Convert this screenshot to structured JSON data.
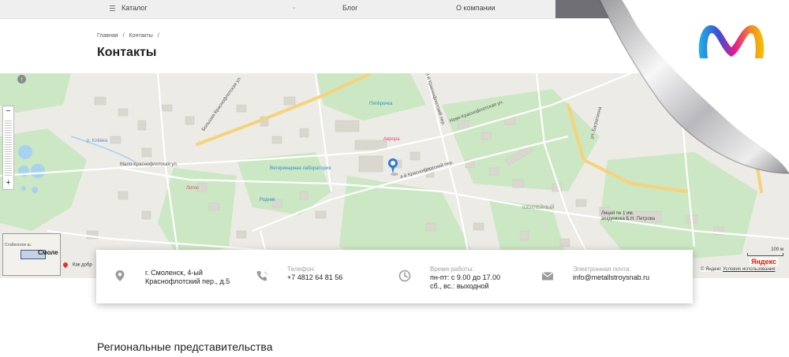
{
  "topnav": {
    "items": [
      {
        "label": "Каталог"
      },
      {
        "label": "Блог"
      },
      {
        "label": "О компании"
      }
    ]
  },
  "breadcrumb": {
    "items": [
      "Главная",
      "/",
      "Контакты",
      "/"
    ]
  },
  "page": {
    "title": "Контакты",
    "section_title": "Региональные представительства"
  },
  "map": {
    "streets": [
      "Ново-Краснофлотская ул.",
      "Мало-Краснофлотская ул.",
      "4-й Краснофлотский пер.",
      "3-й Краснофлотский пер.",
      "Большая Краснофлотская ул.",
      "р. Клёвка",
      "ул. Багратиона"
    ],
    "pois": [
      "Пятёрочка",
      "Аврора",
      "Ветеринарная лаборатория",
      "Лотос",
      "Родник",
      "ЮБИЛЕЙНЫЙ",
      "Лицей № 1 им. академика Б.Н. Петрова"
    ],
    "minimap_city": "Смоле",
    "minimap_tiny": "Стабенское ш.",
    "route_hint": "Как добр",
    "scale_label": "100 м",
    "yandex_logo": "Яндекс",
    "copyright": "© Яндекс",
    "terms_link": "Условия использования"
  },
  "contacts": {
    "address": {
      "icon": "location-pin-icon",
      "line1": "г. Смоленск, 4-ый",
      "line2": "Краснофлотский пер., д.5"
    },
    "phone": {
      "icon": "phone-icon",
      "label": "Телефон:",
      "value": "+7 4812 64 81 56"
    },
    "hours": {
      "icon": "clock-icon",
      "label": "Время работы:",
      "line1": "пн-пт: с 9.00 до 17.00",
      "line2": "сб., вс.: выходной"
    },
    "email": {
      "icon": "mail-icon",
      "label": "Электронная почта:",
      "value": "info@metallstroysnab.ru"
    }
  },
  "colors": {
    "accent_purple": "#6f3fa0",
    "logo_blue": "#1f5bd7",
    "logo_pink": "#e6198c",
    "logo_yellow": "#f5c400",
    "map_green": "#c9e7c0",
    "map_water": "#a8d3ee",
    "pin_blue": "#2d7ad6"
  }
}
